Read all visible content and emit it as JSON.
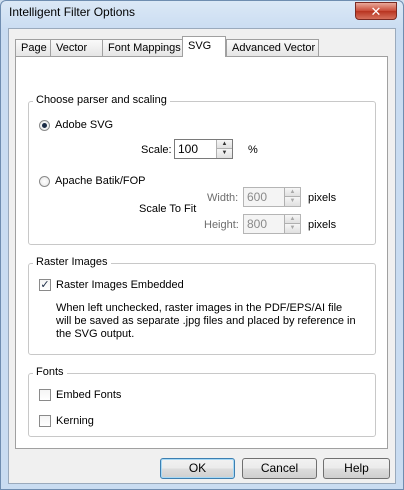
{
  "window": {
    "title": "Intelligent Filter Options",
    "close_glyph": "✕"
  },
  "tabs": [
    {
      "label": "Page"
    },
    {
      "label": "Vector"
    },
    {
      "label": "Font Mappings"
    },
    {
      "label": "SVG",
      "active": true
    },
    {
      "label": "Advanced Vector"
    }
  ],
  "parser_group": {
    "legend": "Choose parser and scaling",
    "adobe_svg": {
      "label": "Adobe SVG",
      "checked": true
    },
    "scale_label": "Scale:",
    "scale_value": "100",
    "scale_unit": "%",
    "batik": {
      "label": "Apache Batik/FOP",
      "checked": false
    },
    "scale_to_fit_label": "Scale To Fit",
    "width_label": "Width:",
    "width_value": "600",
    "width_unit": "pixels",
    "height_label": "Height:",
    "height_value": "800",
    "height_unit": "pixels"
  },
  "raster_group": {
    "legend": "Raster Images",
    "embedded": {
      "label": "Raster Images Embedded",
      "checked": true,
      "glyph": "✓"
    },
    "description": [
      "When left unchecked, raster images in the PDF/EPS/AI file",
      "will be saved as separate .jpg files and placed by reference in",
      "the SVG output."
    ]
  },
  "fonts_group": {
    "legend": "Fonts",
    "embed_fonts": {
      "label": "Embed Fonts",
      "checked": false
    },
    "kerning": {
      "label": "Kerning",
      "checked": false
    }
  },
  "buttons": {
    "ok": "OK",
    "cancel": "Cancel",
    "help": "Help"
  },
  "spinner_up_glyph": "▲",
  "spinner_down_glyph": "▼"
}
